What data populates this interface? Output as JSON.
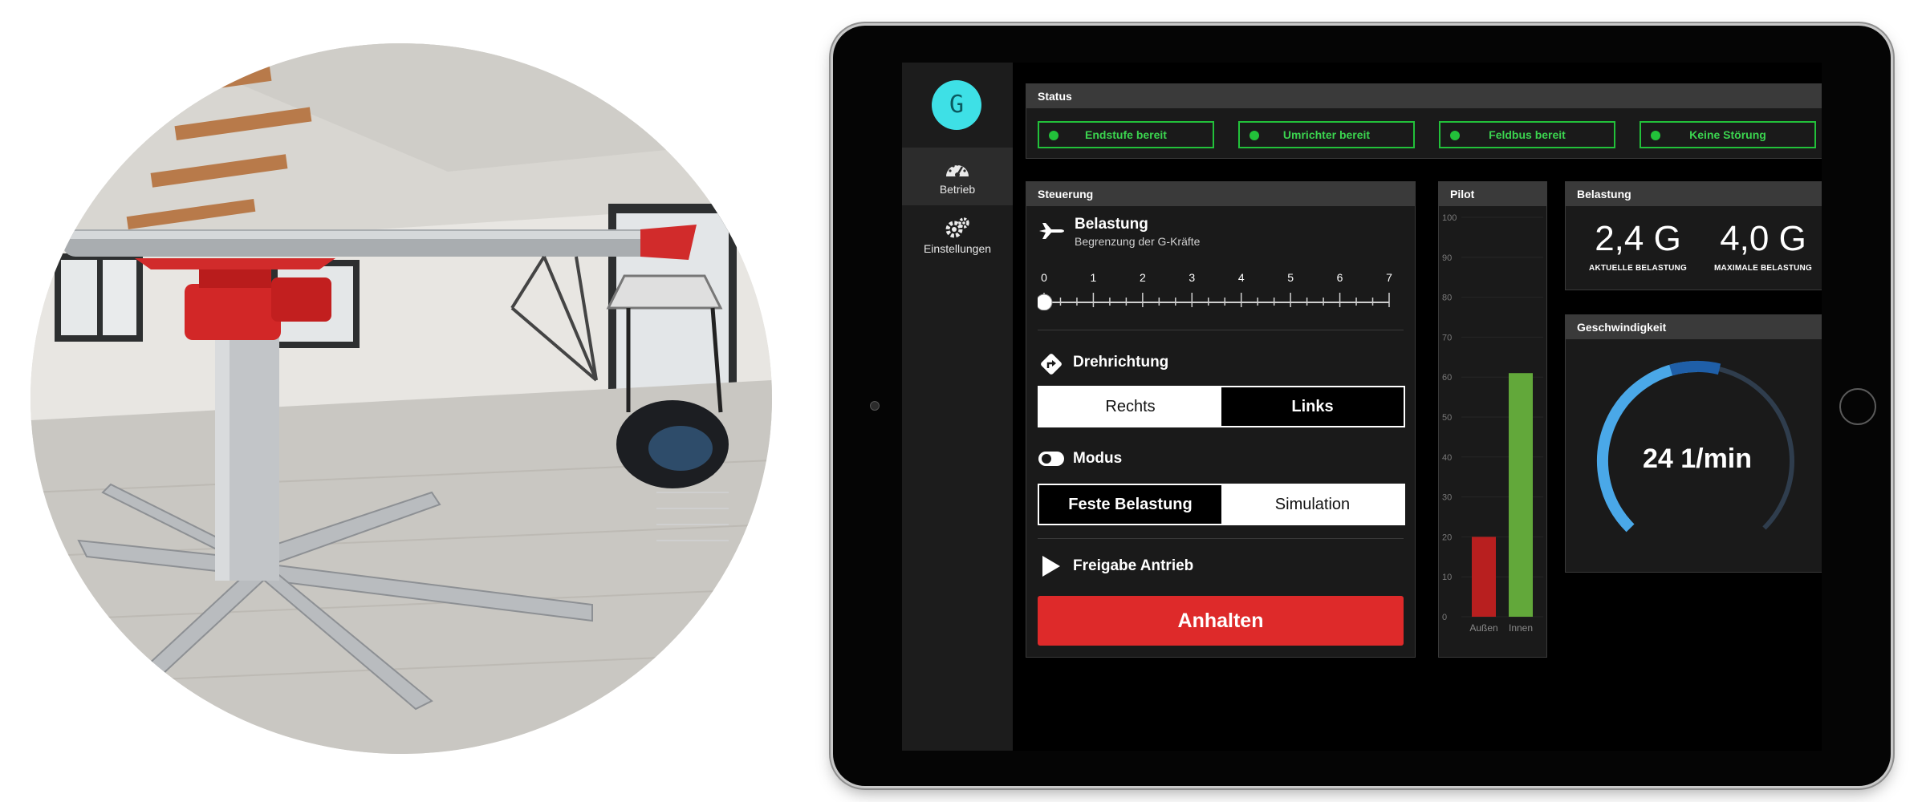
{
  "app": {
    "logo_letter": "G"
  },
  "nav": [
    {
      "label": "Betrieb",
      "icon": "speedometer-icon",
      "active": true
    },
    {
      "label": "Einstellungen",
      "icon": "gears-icon",
      "active": false
    }
  ],
  "status": {
    "title": "Status",
    "items": [
      {
        "label": "Endstufe bereit",
        "color": "#22c13a"
      },
      {
        "label": "Umrichter bereit",
        "color": "#22c13a"
      },
      {
        "label": "Feldbus bereit",
        "color": "#22c13a"
      },
      {
        "label": "Keine Störung",
        "color": "#22c13a"
      }
    ]
  },
  "steuerung": {
    "title": "Steuerung",
    "belastung": {
      "title": "Belastung",
      "subtitle": "Begrenzung der G-Kräfte",
      "slider_ticks": [
        "0",
        "1",
        "2",
        "3",
        "4",
        "5",
        "6",
        "7"
      ],
      "slider_value": 0,
      "slider_min": 0,
      "slider_max": 7
    },
    "drehrichtung": {
      "title": "Drehrichtung",
      "options": [
        "Rechts",
        "Links"
      ],
      "selected": "Links"
    },
    "modus": {
      "title": "Modus",
      "options": [
        "Feste Belastung",
        "Simulation"
      ],
      "selected": "Feste Belastung"
    },
    "freigabe": {
      "title": "Freigabe Antrieb",
      "button_label": "Anhalten",
      "button_color": "#de2a2a"
    }
  },
  "pilot": {
    "title": "Pilot",
    "axis_ticks": [
      "100",
      "90",
      "80",
      "70",
      "60",
      "50",
      "40",
      "30",
      "20",
      "10",
      "0"
    ],
    "bars": [
      {
        "label": "Außen",
        "value": 20,
        "color": "#b81f1f"
      },
      {
        "label": "Innen",
        "value": 61,
        "color": "#62a83a"
      }
    ]
  },
  "belastung_panel": {
    "title": "Belastung",
    "current_value": "2,4 G",
    "current_label": "AKTUELLE BELASTUNG",
    "max_value": "4,0 G",
    "max_label": "MAXIMALE BELASTUNG"
  },
  "geschwindigkeit": {
    "title": "Geschwindigkeit",
    "value_text": "24 1/min",
    "gauge_fraction": 0.5,
    "marker_fraction": 0.55
  },
  "colors": {
    "accent": "#3ee0e6",
    "ok": "#22c13a",
    "danger": "#de2a2a",
    "gauge_light": "#4aa8e8",
    "gauge_dark": "#1f5fa8",
    "gauge_track": "#2f3d4d"
  }
}
